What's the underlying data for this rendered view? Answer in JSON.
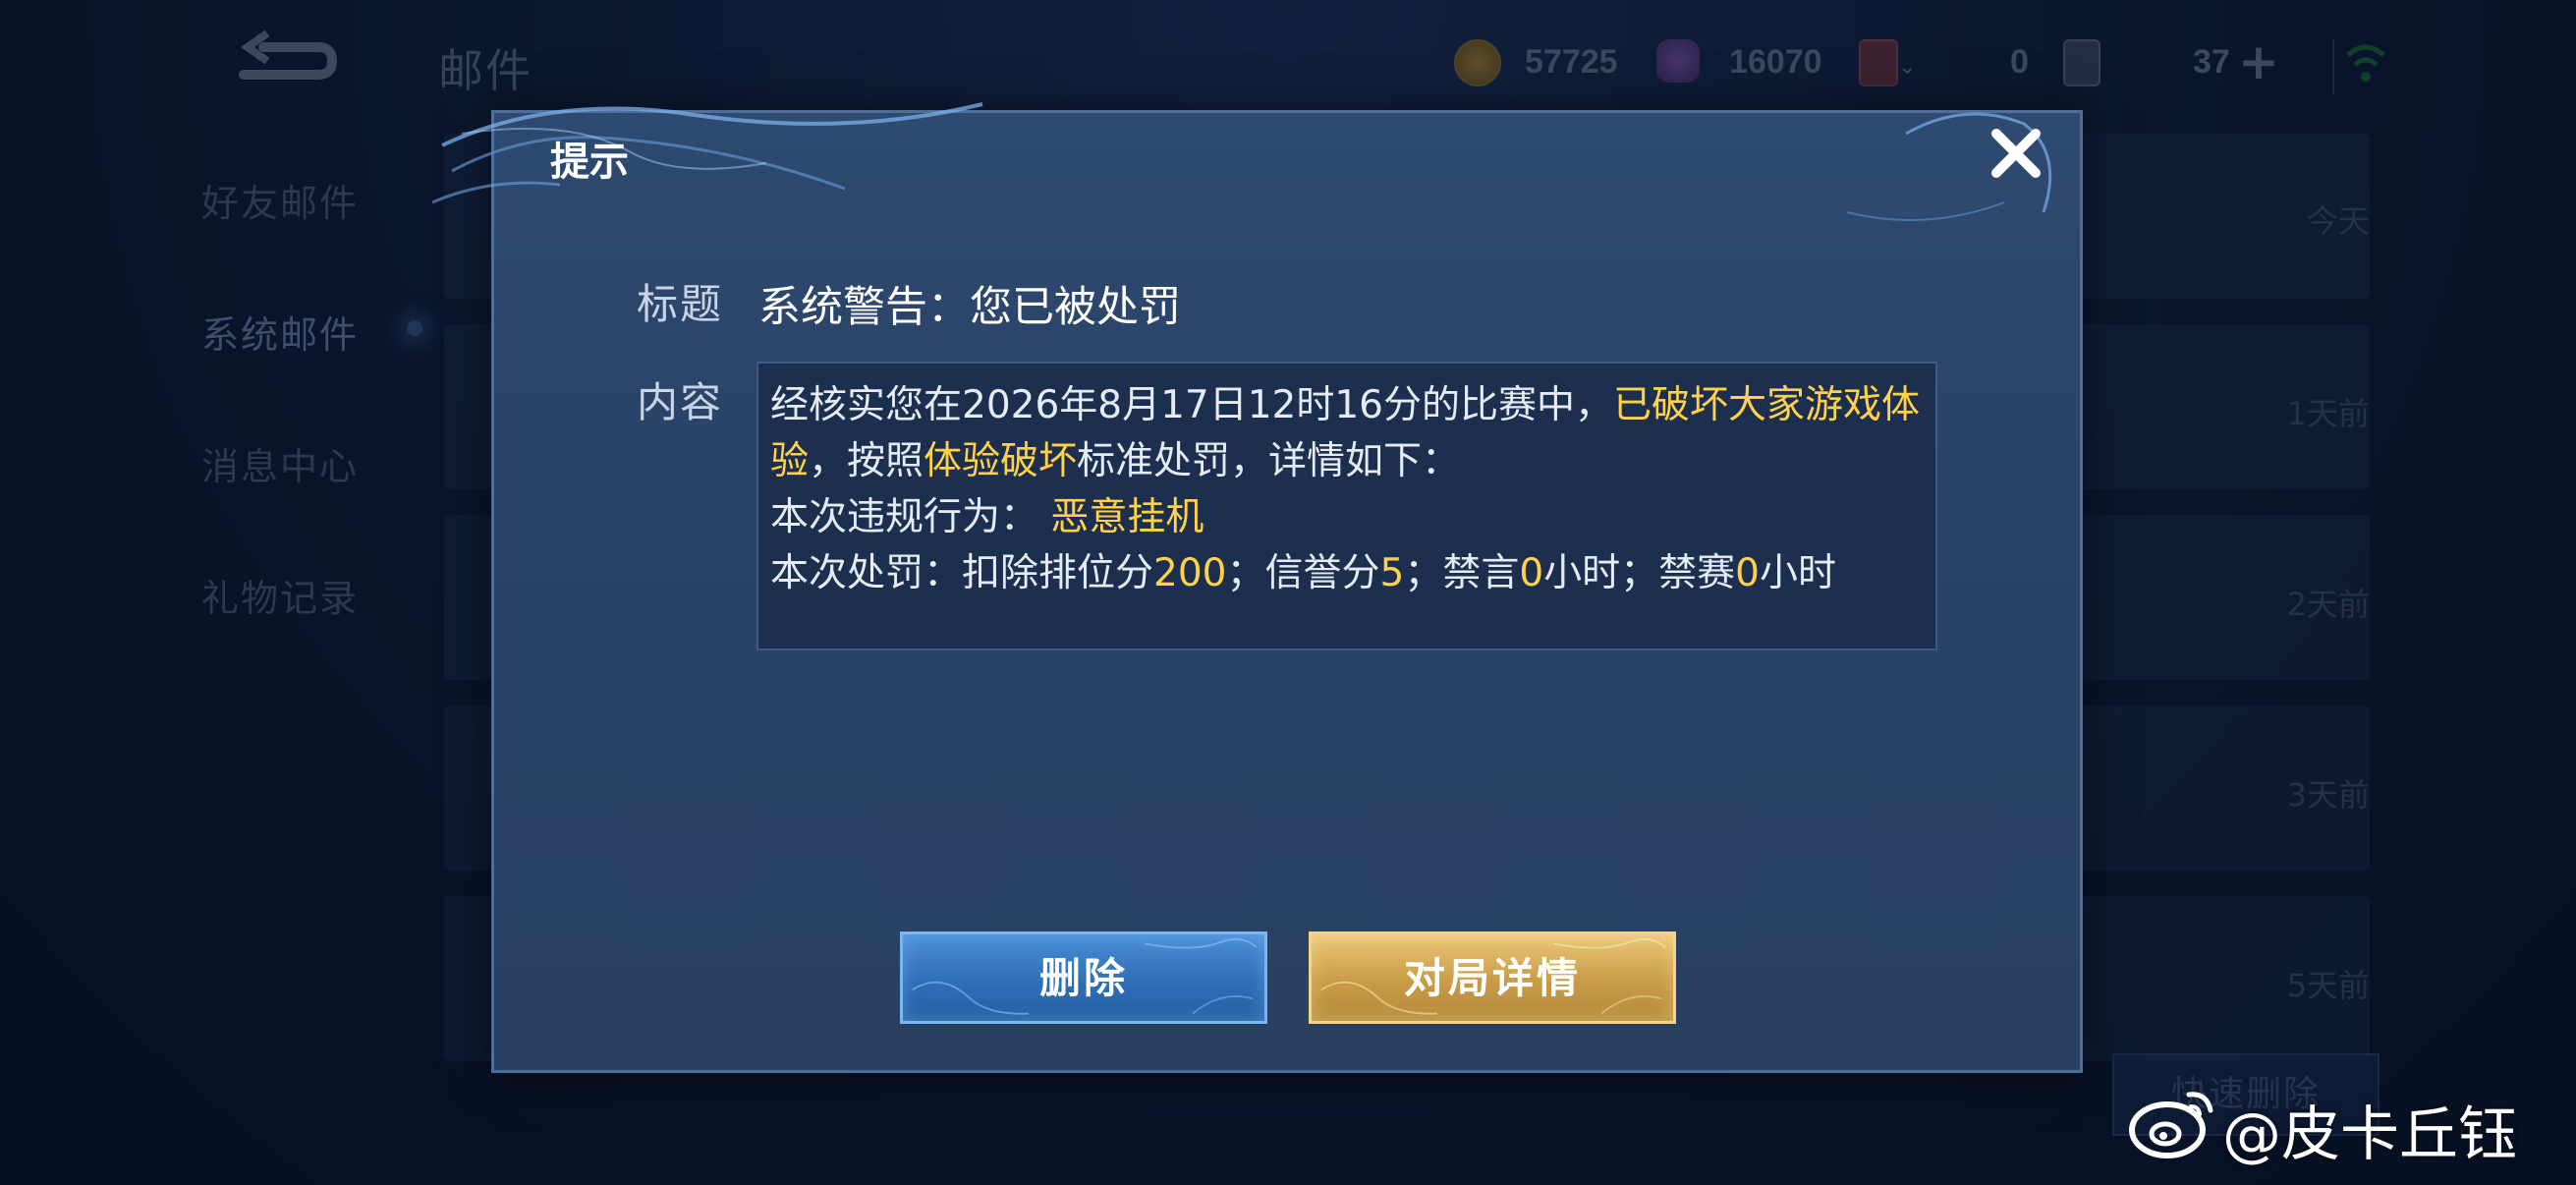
{
  "header": {
    "page_title": "邮件",
    "gold": "57725",
    "diamond": "16070",
    "tickets": "0",
    "coupons": "37"
  },
  "sidebar": {
    "items": [
      {
        "label": "好友邮件"
      },
      {
        "label": "系统邮件"
      },
      {
        "label": "消息中心"
      },
      {
        "label": "礼物记录"
      }
    ]
  },
  "mail_list": {
    "times": [
      "今天",
      "1天前",
      "2天前",
      "3天前",
      "5天前"
    ],
    "quick_delete_label": "快速删除"
  },
  "dialog": {
    "title": "提示",
    "title_label": "标题",
    "title_value": "系统警告：您已被处罚",
    "content_label": "内容",
    "content": {
      "p1_a": "经核实您在2026年8月17日12时16分的比赛中，",
      "p1_b": "已破坏大家游戏体验",
      "p1_c": "，按照",
      "p1_d": "体验破坏",
      "p1_e": "标准处罚，详情如下：",
      "p2_a": "本次违规行为：",
      "p2_b": "恶意挂机",
      "p3_a": "本次处罚：扣除排位分",
      "p3_b": "200",
      "p3_c": "；信誉分",
      "p3_d": "5",
      "p3_e": "；禁言",
      "p3_f": "0",
      "p3_g": "小时；禁赛",
      "p3_h": "0",
      "p3_i": "小时"
    },
    "buttons": {
      "delete": "删除",
      "match_detail": "对局详情"
    }
  },
  "watermark": {
    "text": "@皮卡丘钰"
  },
  "colors": {
    "highlight": "#ffd24a",
    "delete_button": "#2f6fb8",
    "detail_button": "#c99b47"
  }
}
